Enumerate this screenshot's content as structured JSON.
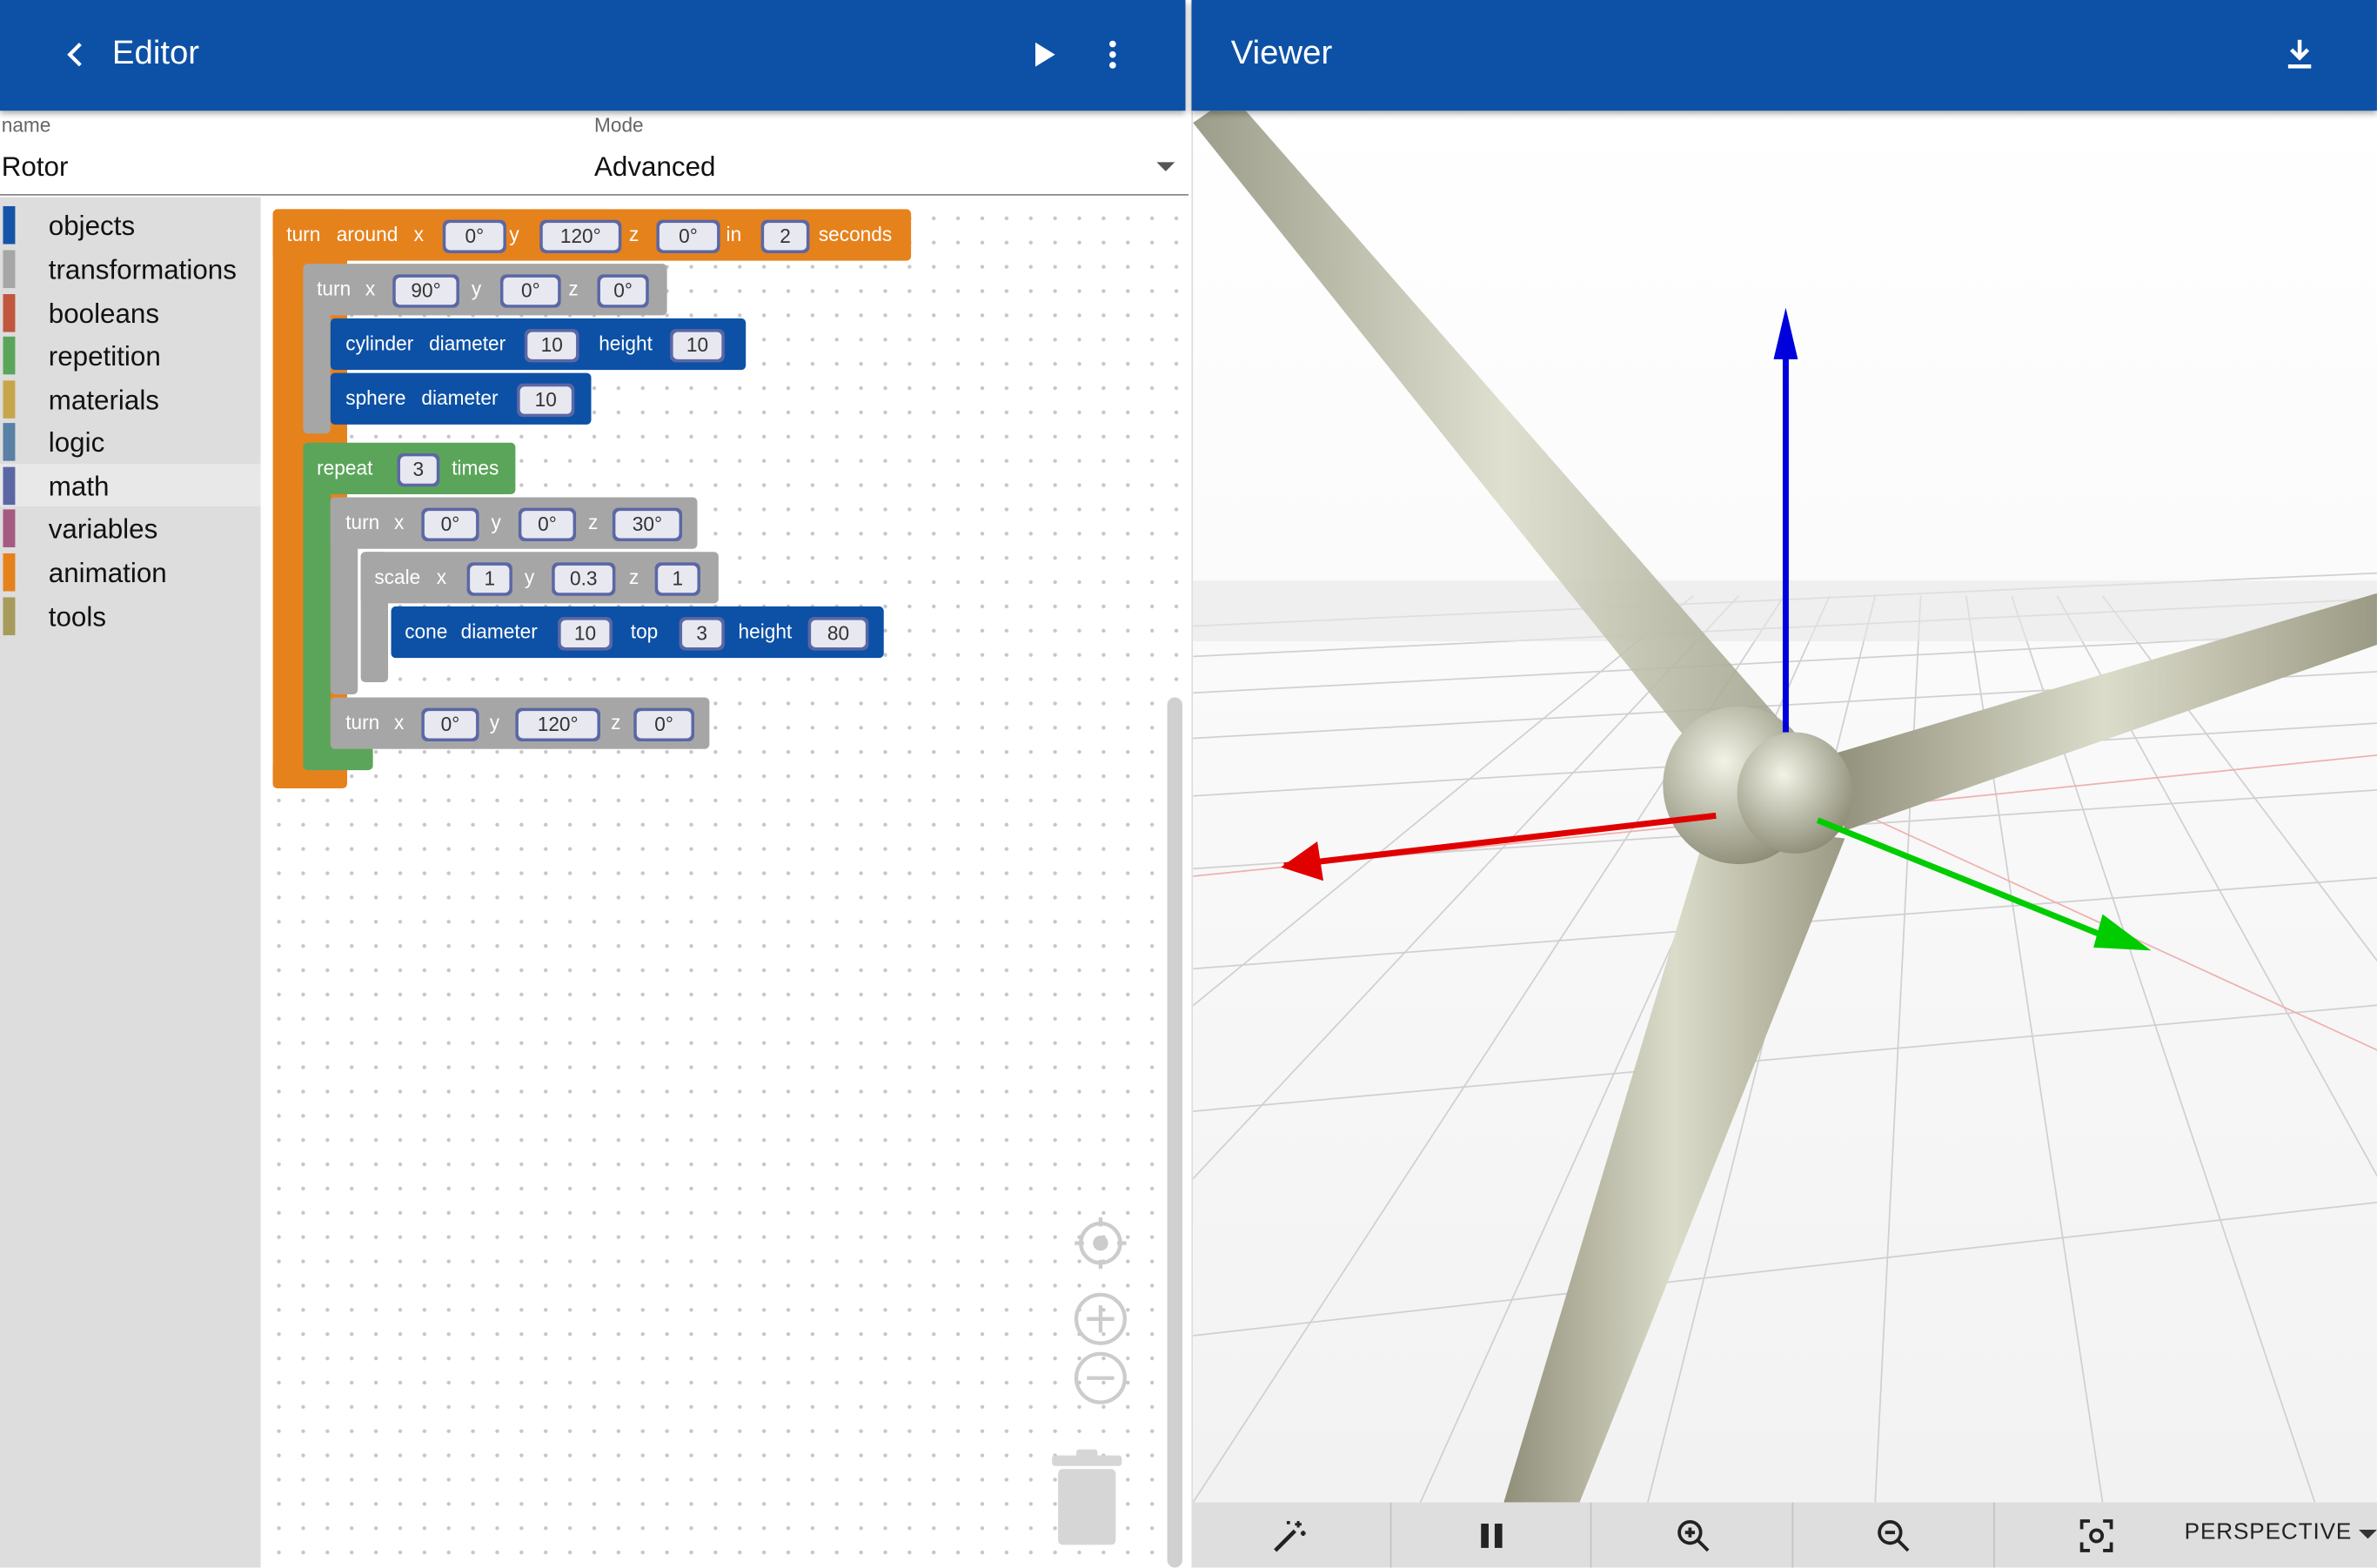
{
  "editor": {
    "title": "Editor",
    "name_label": "name",
    "name_value": "Rotor",
    "mode_label": "Mode",
    "mode_value": "Advanced"
  },
  "viewer": {
    "title": "Viewer",
    "camera_mode": "PERSPECTIVE"
  },
  "toolbox": [
    {
      "label": "objects",
      "color": "#1454a8"
    },
    {
      "label": "transformations",
      "color": "#a6a6a6"
    },
    {
      "label": "booleans",
      "color": "#c0573e"
    },
    {
      "label": "repetition",
      "color": "#5ba55b"
    },
    {
      "label": "materials",
      "color": "#c7a64b"
    },
    {
      "label": "logic",
      "color": "#5b80a5"
    },
    {
      "label": "math",
      "color": "#5b67a5"
    },
    {
      "label": "variables",
      "color": "#a55b80"
    },
    {
      "label": "animation",
      "color": "#e6821c"
    },
    {
      "label": "tools",
      "color": "#a69b5b"
    }
  ],
  "blocks": {
    "turn_around": {
      "w1": "turn",
      "w2": "around",
      "x_label": "x",
      "x": "0°",
      "y_label": "y",
      "y": "120°",
      "z_label": "z",
      "z": "0°",
      "in_label": "in",
      "secs": "2",
      "seconds_label": "seconds"
    },
    "turn1": {
      "w1": "turn",
      "x_label": "x",
      "x": "90°",
      "y_label": "y",
      "y": "0°",
      "z_label": "z",
      "z": "0°"
    },
    "cylinder": {
      "w1": "cylinder",
      "w2": "diameter",
      "diameter": "10",
      "height_label": "height",
      "height": "10"
    },
    "sphere": {
      "w1": "sphere",
      "w2": "diameter",
      "diameter": "10"
    },
    "repeat": {
      "w1": "repeat",
      "count": "3",
      "times_label": "times"
    },
    "turn2": {
      "w1": "turn",
      "x_label": "x",
      "x": "0°",
      "y_label": "y",
      "y": "0°",
      "z_label": "z",
      "z": "30°"
    },
    "scale": {
      "w1": "scale",
      "x_label": "x",
      "x": "1",
      "y_label": "y",
      "y": "0.3",
      "z_label": "z",
      "z": "1"
    },
    "cone": {
      "w1": "cone",
      "w2": "diameter",
      "diameter": "10",
      "top_label": "top",
      "top": "3",
      "height_label": "height",
      "height": "80"
    },
    "turn3": {
      "w1": "turn",
      "x_label": "x",
      "x": "0°",
      "y_label": "y",
      "y": "120°",
      "z_label": "z",
      "z": "0°"
    }
  },
  "colors": {
    "app_bar": "#0d51a6",
    "animation_block": "#e6821c",
    "transform_block": "#a6a6a6",
    "object_block": "#0d51a6",
    "repeat_block": "#5ba55b",
    "axis_x": "#e00000",
    "axis_y": "#00cc00",
    "axis_z": "#0000dd"
  },
  "icons": {
    "back": "chevron-left-icon",
    "run": "play-icon",
    "menu": "more-vert-icon",
    "download": "download-icon",
    "magic": "magic-wand-icon",
    "pause": "pause-icon",
    "zoom_in": "zoom-in-icon",
    "zoom_out": "zoom-out-icon",
    "fit": "center-focus-icon"
  }
}
